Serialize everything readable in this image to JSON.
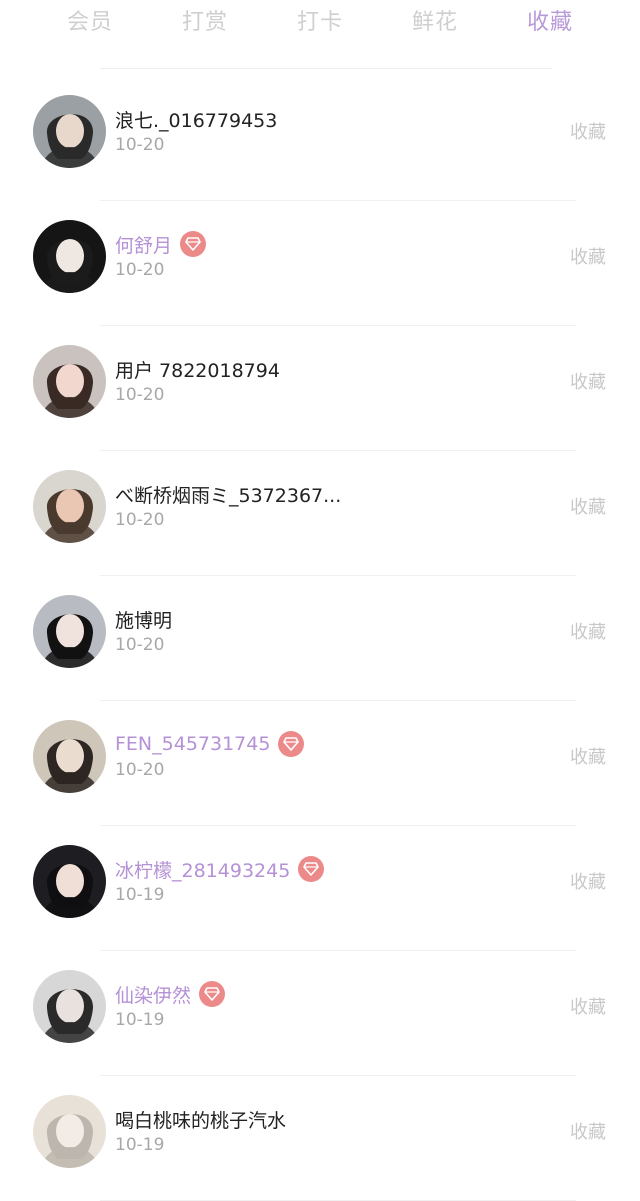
{
  "tabs": [
    "会员",
    "打赏",
    "打卡",
    "鲜花",
    "收藏"
  ],
  "active_tab": "收藏",
  "colors": {
    "accent": "#b79ad8",
    "vip_name": "#b591d6",
    "vip_badge": "#ec8a8a",
    "inactive_tab": "#cfcfcf",
    "date": "#a8a8a8",
    "action": "#c8c8c8"
  },
  "rows": [
    {
      "name": "浪七._016779453",
      "vip": false,
      "date": "10-20",
      "action": "收藏",
      "avatar": {
        "icon": "user-avatar",
        "bg": "#9aa0a3",
        "skin": "#e8d8cc",
        "hair": "#2a2a2a"
      }
    },
    {
      "name": "何舒月",
      "vip": true,
      "date": "10-20",
      "action": "收藏",
      "avatar": {
        "icon": "user-avatar",
        "bg": "#151515",
        "skin": "#efe7e2",
        "hair": "#1b1b1b"
      }
    },
    {
      "name": "用户 7822018794",
      "vip": false,
      "date": "10-20",
      "action": "收藏",
      "avatar": {
        "icon": "user-avatar",
        "bg": "#c9c2bf",
        "skin": "#f2d7cf",
        "hair": "#3a2a25"
      }
    },
    {
      "name": "べ断桥烟雨ミ_5372367...",
      "vip": false,
      "date": "10-20",
      "action": "收藏",
      "avatar": {
        "icon": "user-avatar",
        "bg": "#d9d6cf",
        "skin": "#eac7b2",
        "hair": "#4a3a2e"
      }
    },
    {
      "name": "施博明",
      "vip": false,
      "date": "10-20",
      "action": "收藏",
      "avatar": {
        "icon": "user-avatar",
        "bg": "#b8bcc2",
        "skin": "#f0e2dc",
        "hair": "#121212"
      }
    },
    {
      "name": "FEN_545731745",
      "vip": true,
      "date": "10-20",
      "action": "收藏",
      "avatar": {
        "icon": "user-avatar",
        "bg": "#cfc6ba",
        "skin": "#eadccf",
        "hair": "#2d2622"
      }
    },
    {
      "name": "冰柠檬_281493245",
      "vip": true,
      "date": "10-19",
      "action": "收藏",
      "avatar": {
        "icon": "user-avatar",
        "bg": "#1d1d22",
        "skin": "#f0dfd6",
        "hair": "#0f0f12"
      }
    },
    {
      "name": "仙染伊然",
      "vip": true,
      "date": "10-19",
      "action": "收藏",
      "avatar": {
        "icon": "user-avatar",
        "bg": "#d7d7d7",
        "skin": "#e9e1dd",
        "hair": "#2a2a2a"
      }
    },
    {
      "name": "喝白桃味的桃子汽水",
      "vip": false,
      "date": "10-19",
      "action": "收藏",
      "avatar": {
        "icon": "user-avatar",
        "bg": "#e7e1d7",
        "skin": "#f3ece6",
        "hair": "#bdb6ae"
      }
    }
  ]
}
